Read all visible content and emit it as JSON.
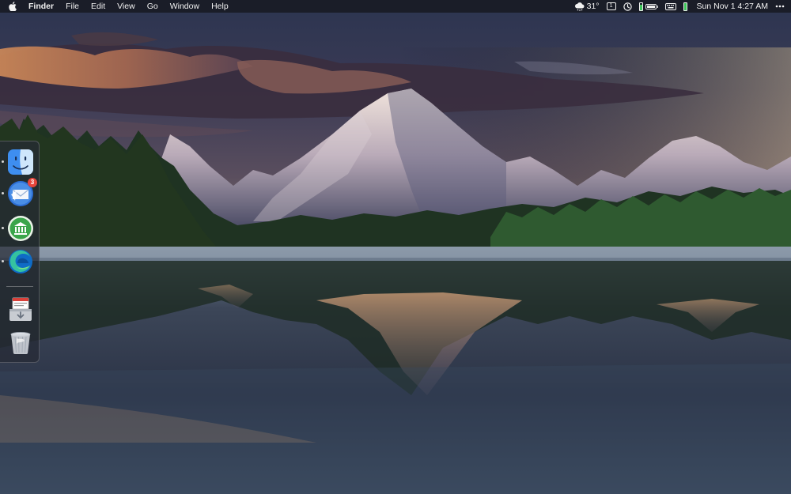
{
  "menubar": {
    "apple_icon": "apple-logo-icon",
    "app_name": "Finder",
    "menus": [
      "File",
      "Edit",
      "View",
      "Go",
      "Window",
      "Help"
    ],
    "weather": {
      "icon": "cloud-snow-icon",
      "temperature": "31°"
    },
    "input_badge": "1",
    "clock": "Sun Nov 1  4:27 AM",
    "overflow_icon": "ellipsis-icon"
  },
  "dock": {
    "items": [
      {
        "name": "Finder",
        "icon": "finder-icon",
        "running": true
      },
      {
        "name": "Mail",
        "icon": "mail-icon",
        "badge": "3",
        "running": true
      },
      {
        "name": "Bank",
        "icon": "bank-icon",
        "running": true
      },
      {
        "name": "Microsoft Edge",
        "icon": "edge-icon",
        "running": true
      },
      {
        "name": "Downloads",
        "icon": "downloads-stack-icon",
        "running": false
      },
      {
        "name": "Trash",
        "icon": "trash-icon",
        "running": false
      }
    ]
  },
  "colors": {
    "menubar_bg": "#16181f",
    "badge_red": "#e8453c",
    "battery_green": "#3ec65a"
  }
}
